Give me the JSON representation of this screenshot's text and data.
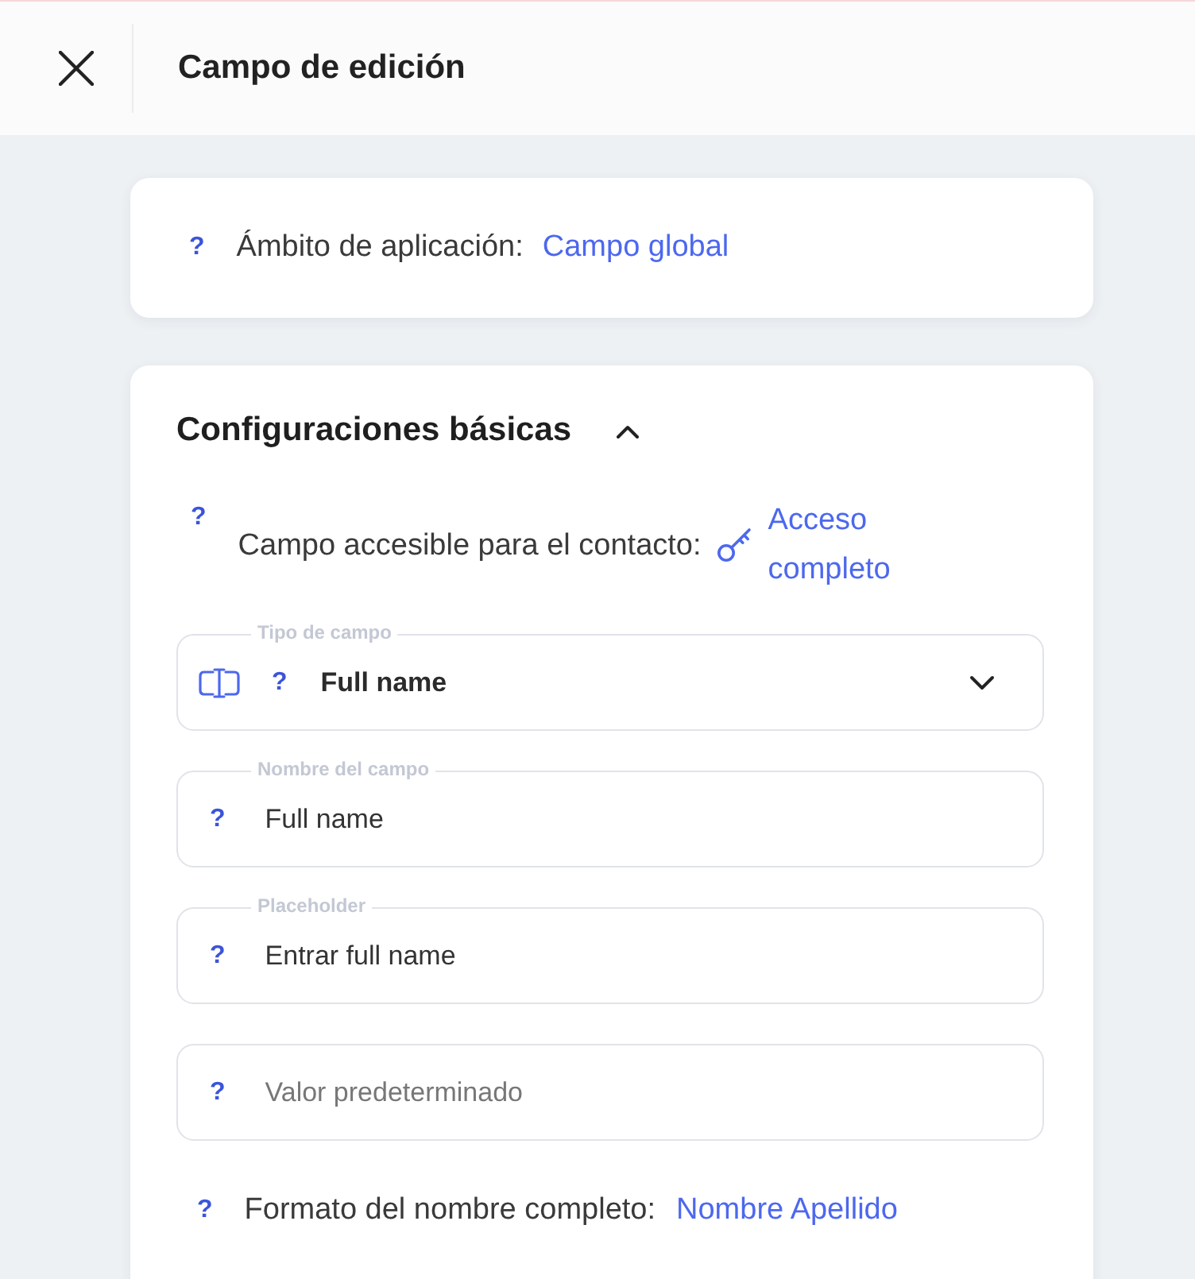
{
  "header": {
    "title": "Campo de edición"
  },
  "scope": {
    "help": "?",
    "label": "Ámbito de aplicación:",
    "value": "Campo global"
  },
  "section": {
    "title": "Configuraciones básicas",
    "expanded": true,
    "access": {
      "help": "?",
      "label": "Campo accesible para el contacto:",
      "value": "Acceso completo"
    },
    "fields": [
      {
        "kind": "select",
        "label": "Tipo de campo",
        "help": "?",
        "value": "Full name"
      },
      {
        "kind": "text",
        "label": "Nombre del campo",
        "help": "?",
        "value": "Full name"
      },
      {
        "kind": "text",
        "label": "Placeholder",
        "help": "?",
        "value": "Entrar full name"
      },
      {
        "kind": "text",
        "help": "?",
        "placeholder": "Valor predeterminado"
      }
    ],
    "format": {
      "help": "?",
      "label": "Formato del nombre completo:",
      "value": "Nombre Apellido"
    }
  }
}
